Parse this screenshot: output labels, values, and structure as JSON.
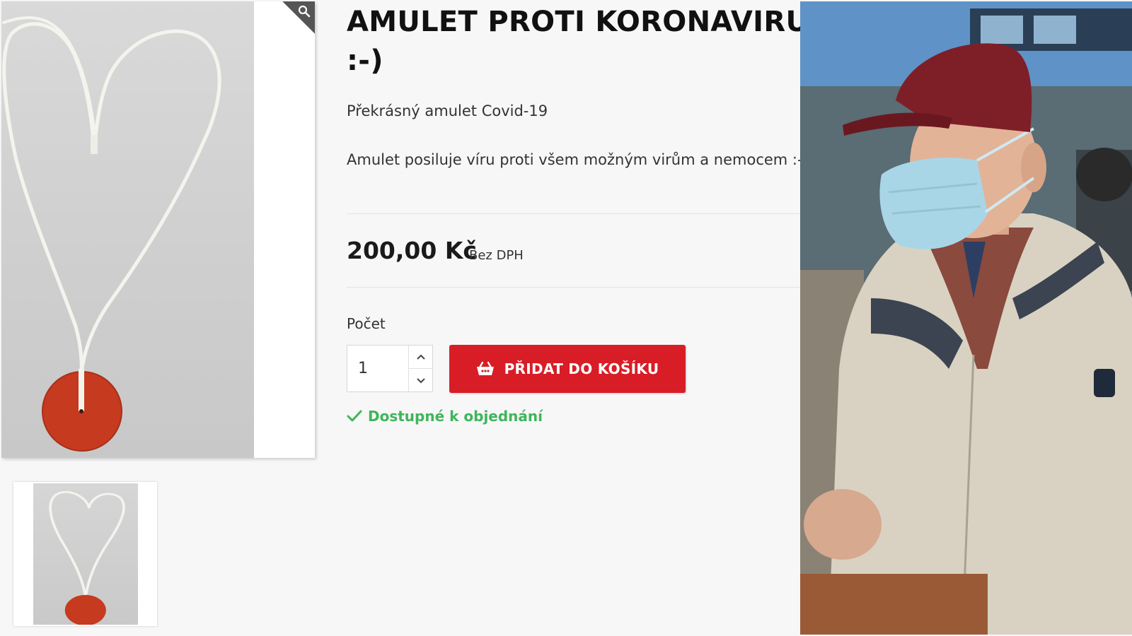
{
  "product": {
    "title": "AMULET PROTI KORONAVIRU :-)",
    "subtitle": "Překrásný amulet  Covid-19",
    "description": "Amulet posiluje víru proti všem možným virům a nemocem :-)",
    "price": "200,00 Kč",
    "price_note": "Bez DPH",
    "quantity_label": "Počet",
    "quantity_value": "1",
    "add_to_cart_label": "PŘIDAT DO KOŠÍKU",
    "availability": "Dostupné k objednání"
  },
  "colors": {
    "button": "#d81d26",
    "availability": "#3fb55b",
    "pendant": "#c63a1f"
  },
  "icons": {
    "zoom": "magnifier-icon",
    "cart": "basket-icon",
    "qty_up": "chevron-up-icon",
    "qty_down": "chevron-down-icon",
    "available": "checkmark-icon"
  }
}
